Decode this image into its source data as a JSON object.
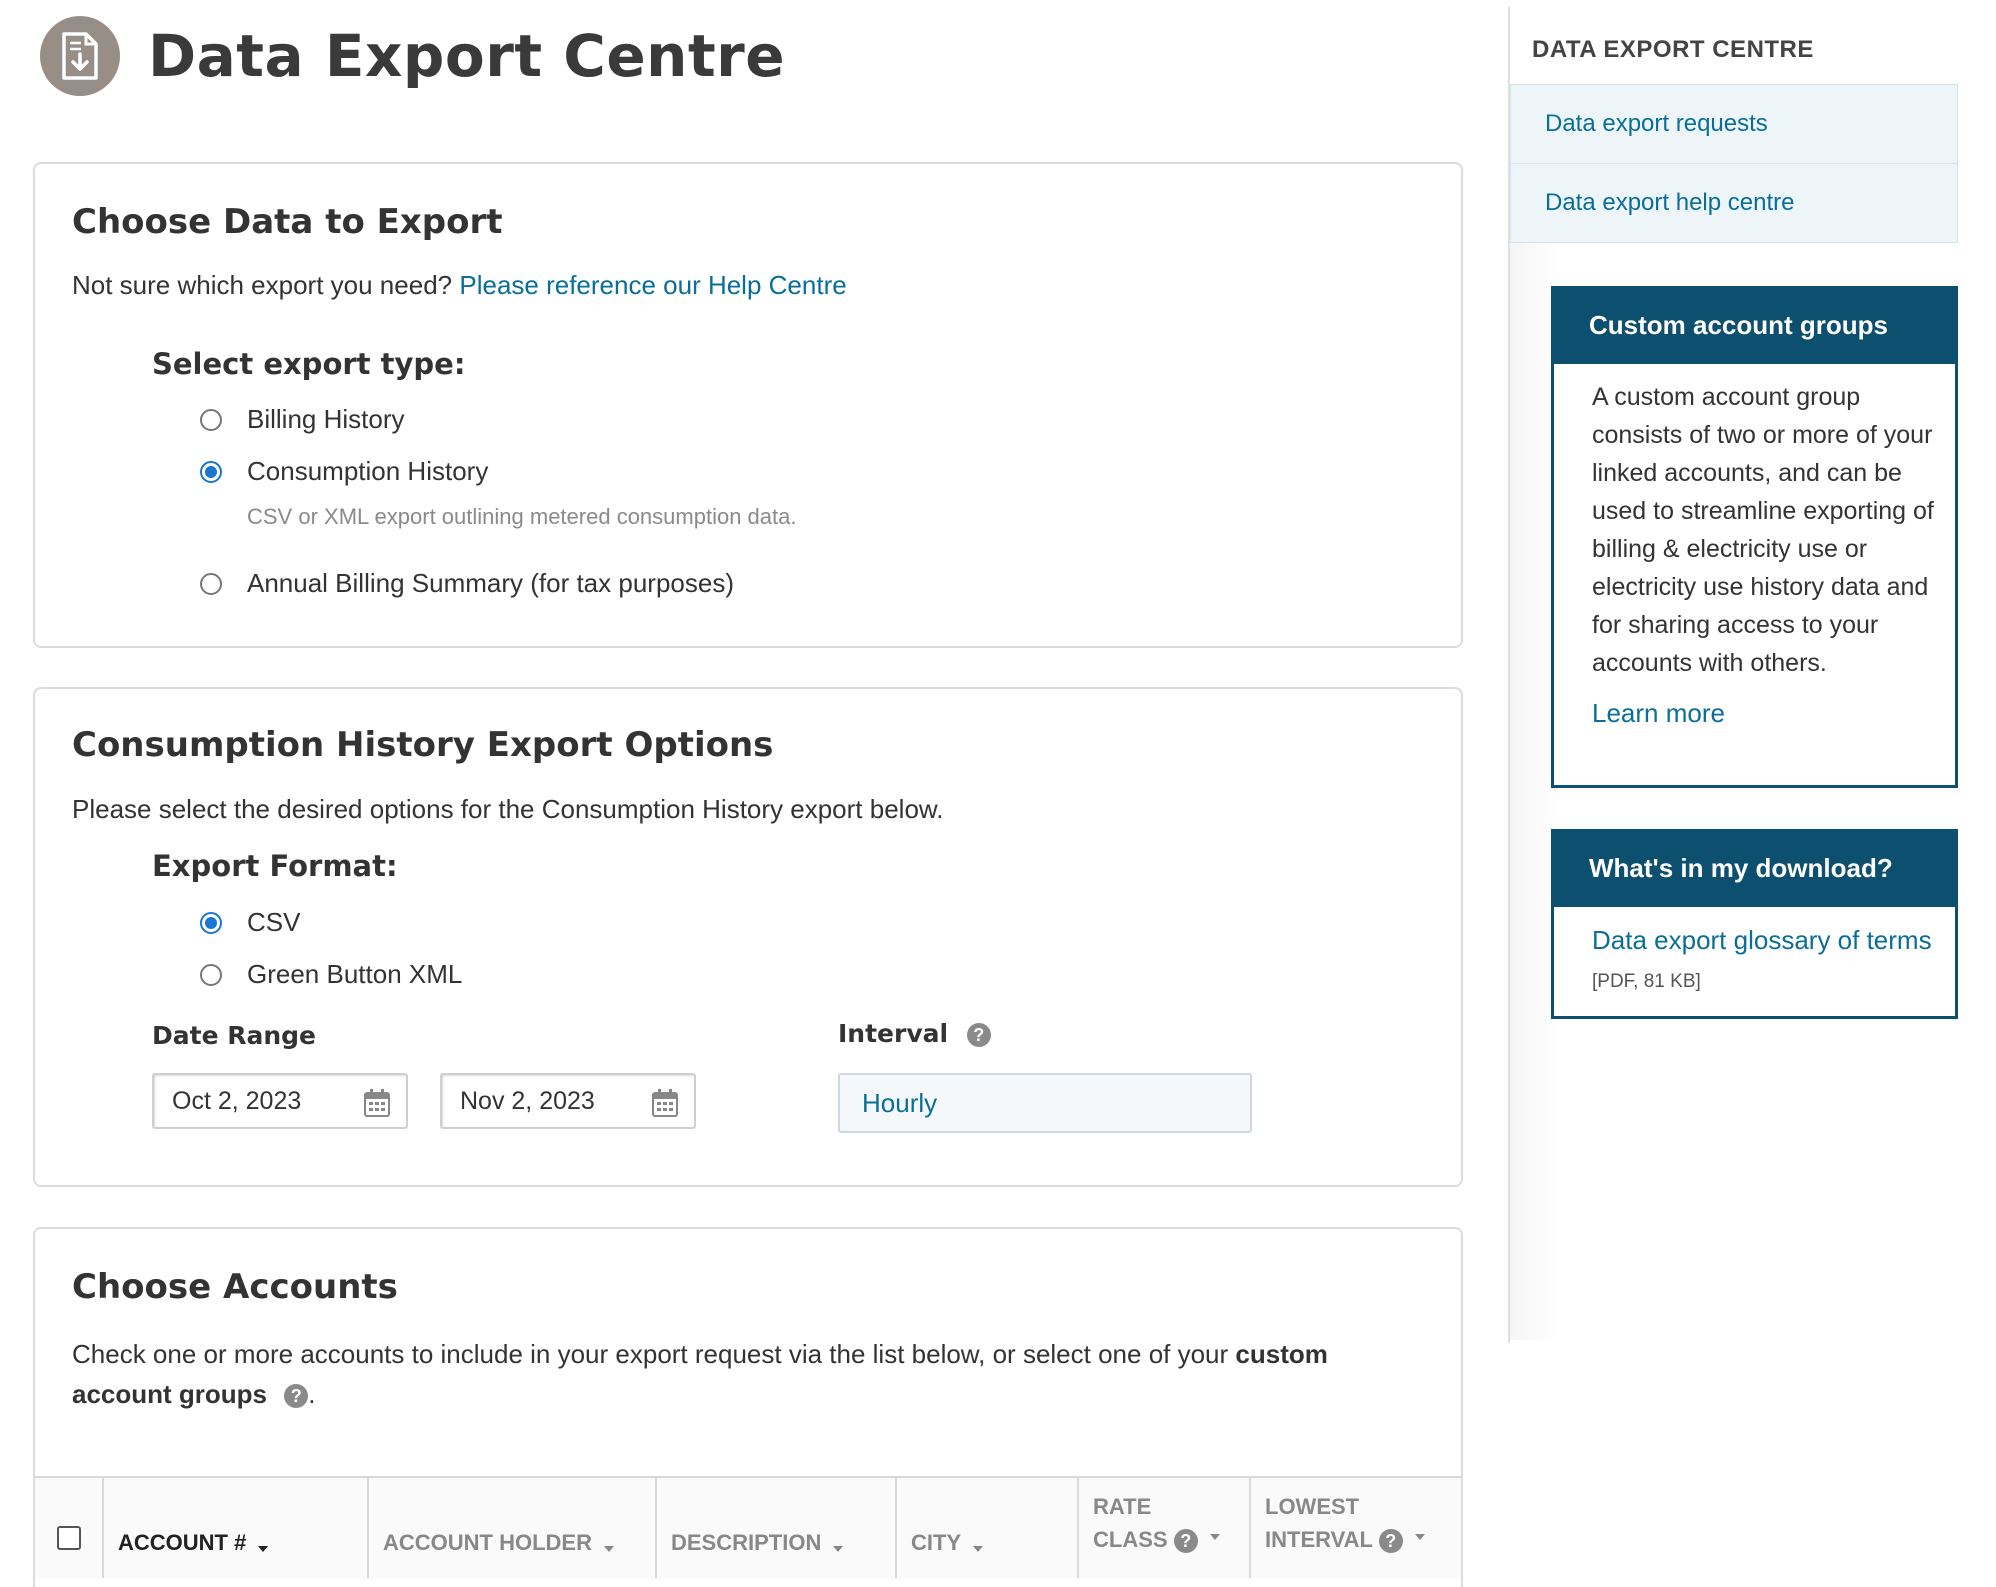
{
  "header": {
    "title": "Data Export Centre",
    "icon": "download-document-icon"
  },
  "choose_data": {
    "title": "Choose Data to Export",
    "help_prompt": "Not sure which export you need?",
    "help_link": "Please reference our Help Centre",
    "export_type_label": "Select export type:",
    "options": [
      {
        "label": "Billing History",
        "checked": false
      },
      {
        "label": "Consumption History",
        "checked": true,
        "description": "CSV or XML export outlining metered consumption data."
      },
      {
        "label": "Annual Billing Summary (for tax purposes)",
        "checked": false
      }
    ]
  },
  "consumption_options": {
    "title": "Consumption History Export Options",
    "intro": "Please select the desired options for the Consumption History export below.",
    "format_label": "Export Format:",
    "formats": [
      {
        "label": "CSV",
        "checked": true
      },
      {
        "label": "Green Button XML",
        "checked": false
      }
    ],
    "date_range_label": "Date Range",
    "start_date": "Oct 2, 2023",
    "end_date": "Nov 2, 2023",
    "interval_label": "Interval",
    "interval_value": "Hourly"
  },
  "choose_accounts": {
    "title": "Choose Accounts",
    "intro_text": "Check one or more accounts to include in your export request via the list below, or select one of your",
    "intro_bold": "custom account groups",
    "intro_end": ".",
    "columns": [
      {
        "label": "Account #"
      },
      {
        "label": "Account Holder"
      },
      {
        "label": "Description"
      },
      {
        "label": "City"
      },
      {
        "label_line1": "Rate",
        "label_line2": "Class"
      },
      {
        "label_line1": "Lowest",
        "label_line2": "Interval"
      }
    ]
  },
  "sidebar": {
    "heading": "DATA EXPORT CENTRE",
    "nav": [
      "Data export requests",
      "Data export help centre"
    ],
    "custom_groups": {
      "title": "Custom account groups",
      "body": "A custom account group consists of two or more of your linked accounts, and can be used to streamline exporting of billing & electricity use or electricity use history data and for sharing access to your accounts with others.",
      "link": "Learn more"
    },
    "download": {
      "title": "What's in my download?",
      "link": "Data export glossary of terms",
      "note": "[PDF, 81 KB]"
    }
  },
  "colors": {
    "link": "#0a6e98",
    "sidebar_box": "#0d4f6e",
    "radio_selected": "#1976d2",
    "header_icon_bg": "#978e87"
  }
}
